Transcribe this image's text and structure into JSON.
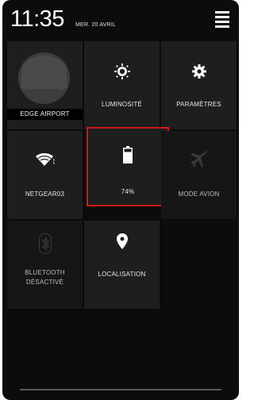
{
  "status": {
    "time": "11:35",
    "date": "MER. 20 AVRIL"
  },
  "menu_icon": "hamburger-menu-icon",
  "tiles": {
    "profile": {
      "label": "EDGE AIRPORT",
      "icon": "avatar"
    },
    "brightness": {
      "label": "LUMINOSITÉ",
      "icon": "sun-icon"
    },
    "settings": {
      "label": "PARAMÈTRES",
      "icon": "gear-icon"
    },
    "wifi": {
      "label": "NETGEAR03",
      "icon": "wifi-icon"
    },
    "battery": {
      "label": "74%",
      "icon": "battery-icon",
      "level": 0.74
    },
    "airplane": {
      "label": "MODE AVION",
      "icon": "airplane-icon"
    },
    "bluetooth": {
      "label_line1": "BLUETOOTH",
      "label_line2": "DÉSACTIVÉ",
      "icon": "bluetooth-icon"
    },
    "location": {
      "label": "LOCALISATION",
      "icon": "location-pin-icon"
    }
  },
  "colors": {
    "panel_bg": "#0c0c0c",
    "tile_bg": "#1e1e1e",
    "highlight": "#d01818",
    "text": "#e8e8e8"
  }
}
